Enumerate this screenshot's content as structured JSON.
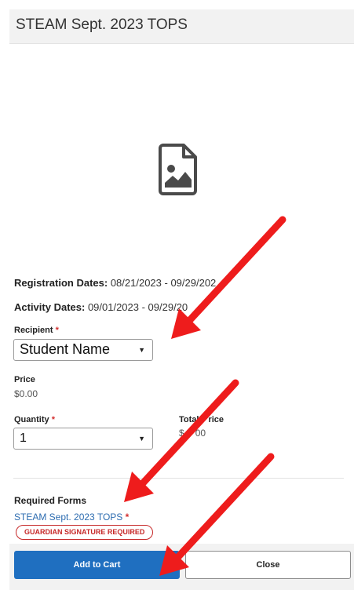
{
  "header": {
    "title": "STEAM Sept. 2023 TOPS"
  },
  "image_placeholder": {
    "icon": "image-placeholder-icon"
  },
  "details": {
    "registration_label": "Registration Dates:",
    "registration_value": "08/21/2023 - 09/29/202",
    "activity_label": "Activity Dates:",
    "activity_value": "09/01/2023 - 09/29/20"
  },
  "recipient": {
    "label": "Recipient",
    "required_mark": "*",
    "selected": "Student Name",
    "caret": "▼"
  },
  "price": {
    "label": "Price",
    "value": "$0.00"
  },
  "quantity": {
    "label": "Quantity",
    "required_mark": "*",
    "selected": "1",
    "caret": "▼"
  },
  "total_price": {
    "label_visible": "Total",
    "label_visible_end": "rice",
    "value_visible_start": "$",
    "value_visible_end": "00"
  },
  "required_forms": {
    "title": "Required Forms",
    "form_name": "STEAM Sept. 2023 TOPS",
    "required_mark": "*",
    "badge": "GUARDIAN SIGNATURE REQUIRED"
  },
  "actions": {
    "add_to_cart": "Add to Cart",
    "close": "Close"
  },
  "colors": {
    "primary_button": "#1f6fc0",
    "link": "#2d6cb0",
    "badge_red": "#c62828",
    "annotation_arrow": "#ee1c1c"
  }
}
